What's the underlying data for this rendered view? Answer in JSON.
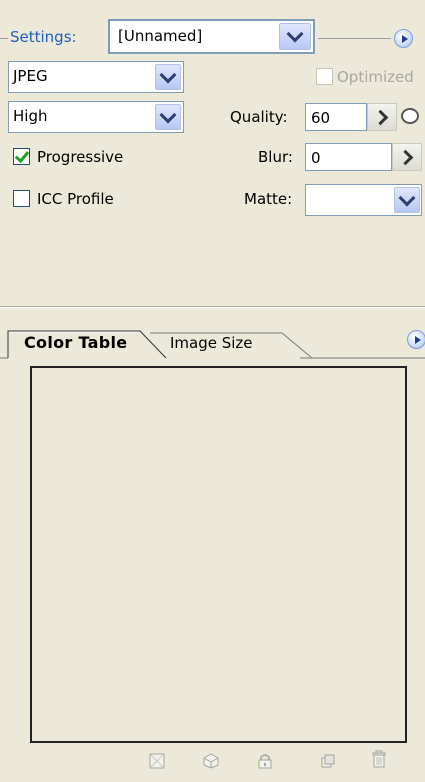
{
  "settings": {
    "label": "Settings:",
    "preset_value": "[Unnamed]"
  },
  "format": {
    "value": "JPEG"
  },
  "quality_preset": {
    "value": "High"
  },
  "optimized": {
    "label": "Optimized",
    "checked": false,
    "enabled": false
  },
  "quality": {
    "label": "Quality:",
    "value": "60"
  },
  "progressive": {
    "label": "Progressive",
    "checked": true
  },
  "blur": {
    "label": "Blur:",
    "value": "0"
  },
  "icc_profile": {
    "label": "ICC Profile",
    "checked": false
  },
  "matte": {
    "label": "Matte:",
    "value": ""
  },
  "tabs": [
    {
      "label": "Color Table",
      "active": true
    },
    {
      "label": "Image Size",
      "active": false
    }
  ],
  "footer_icons": [
    "map-transparent-icon",
    "web-shift-icon",
    "lock-color-icon",
    "new-color-icon",
    "delete-color-icon"
  ],
  "colors": {
    "accent": "#1f5fbf",
    "panel": "#ece9d8"
  }
}
